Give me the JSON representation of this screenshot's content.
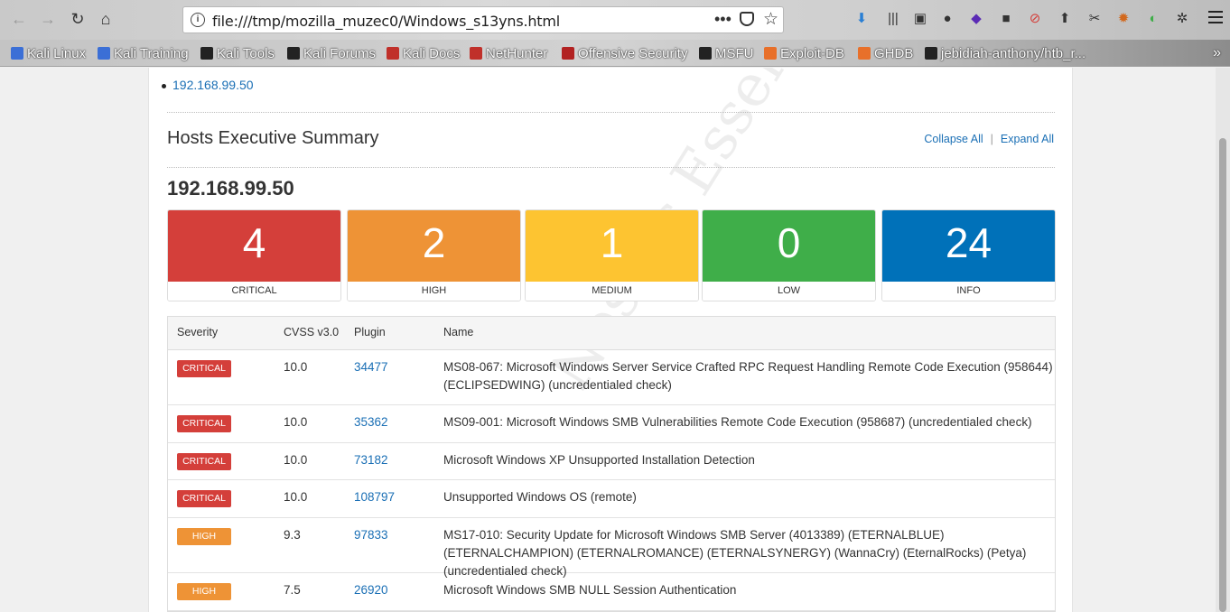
{
  "browser": {
    "url": "file:///tmp/mozilla_muzec0/Windows_s13yns.html",
    "bookmarks": [
      {
        "label": "Kali Linux",
        "color": "#3b6fd6"
      },
      {
        "label": "Kali Training",
        "color": "#3b6fd6"
      },
      {
        "label": "Kali Tools",
        "color": "#222222"
      },
      {
        "label": "Kali Forums",
        "color": "#222222"
      },
      {
        "label": "Kali Docs",
        "color": "#c0302a"
      },
      {
        "label": "NetHunter",
        "color": "#c0302a"
      },
      {
        "label": "Offensive Security",
        "color": "#b22222"
      },
      {
        "label": "MSFU",
        "color": "#222222"
      },
      {
        "label": "Exploit-DB",
        "color": "#e8702a"
      },
      {
        "label": "GHDB",
        "color": "#e8702a"
      },
      {
        "label": "jebidiah-anthony/htb_r...",
        "color": "#222222"
      }
    ]
  },
  "page": {
    "host_link": "192.168.99.50",
    "section_title": "Hosts Executive Summary",
    "collapse_all": "Collapse All",
    "separator": "|",
    "expand_all": "Expand All",
    "host": "192.168.99.50",
    "watermark": "Nessus Essentials",
    "severity_counts": [
      {
        "count": "4",
        "label": "CRITICAL",
        "color": "#d43f3a"
      },
      {
        "count": "2",
        "label": "HIGH",
        "color": "#ee9336"
      },
      {
        "count": "1",
        "label": "MEDIUM",
        "color": "#fdc431"
      },
      {
        "count": "0",
        "label": "LOW",
        "color": "#3fae49"
      },
      {
        "count": "24",
        "label": "INFO",
        "color": "#0071b9"
      }
    ],
    "table": {
      "headers": {
        "severity": "Severity",
        "cvss": "CVSS v3.0",
        "plugin": "Plugin",
        "name": "Name"
      },
      "rows": [
        {
          "severity": "CRITICAL",
          "cvss": "10.0",
          "plugin": "34477",
          "name": "MS08-067: Microsoft Windows Server Service Crafted RPC Request Handling Remote Code Execution (958644) (ECLIPSEDWING) (uncredentialed check)"
        },
        {
          "severity": "CRITICAL",
          "cvss": "10.0",
          "plugin": "35362",
          "name": "MS09-001: Microsoft Windows SMB Vulnerabilities Remote Code Execution (958687) (uncredentialed check)"
        },
        {
          "severity": "CRITICAL",
          "cvss": "10.0",
          "plugin": "73182",
          "name": "Microsoft Windows XP Unsupported Installation Detection"
        },
        {
          "severity": "CRITICAL",
          "cvss": "10.0",
          "plugin": "108797",
          "name": "Unsupported Windows OS (remote)"
        },
        {
          "severity": "HIGH",
          "cvss": "9.3",
          "plugin": "97833",
          "name": "MS17-010: Security Update for Microsoft Windows SMB Server (4013389) (ETERNALBLUE) (ETERNALCHAMPION) (ETERNALROMANCE) (ETERNALSYNERGY) (WannaCry) (EternalRocks) (Petya) (uncredentialed check)"
        },
        {
          "severity": "HIGH",
          "cvss": "7.5",
          "plugin": "26920",
          "name": "Microsoft Windows SMB NULL Session Authentication"
        }
      ]
    },
    "badge_colors": {
      "CRITICAL": "#d43f3a",
      "HIGH": "#ee9336"
    }
  }
}
